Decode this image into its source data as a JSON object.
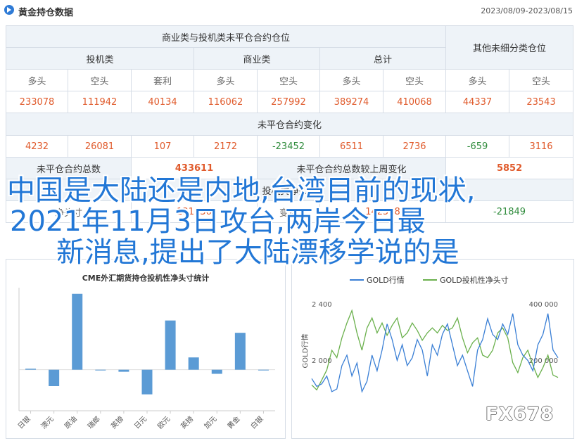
{
  "header": {
    "title": "黄金持仓数据",
    "date_range": "2023/08/09-2023/08/15"
  },
  "table": {
    "section_commercial": "商业类与投机类未平仓合约仓位",
    "section_other": "其他未细分类仓位",
    "groups": [
      "投机类",
      "商业类",
      "总计"
    ],
    "col_labels": [
      "多头",
      "空头",
      "套利",
      "多头",
      "空头",
      "多头",
      "空头",
      "多头",
      "空头"
    ],
    "positions": [
      "233078",
      "111942",
      "40134",
      "116062",
      "257992",
      "389274",
      "410068",
      "44337",
      "23543"
    ],
    "change_title": "未平仓合约变化",
    "changes": [
      "4232",
      "26081",
      "107",
      "2172",
      "-23452",
      "6511",
      "2736",
      "-659",
      "3116"
    ],
    "oi_total_label": "未平仓合约总数",
    "oi_total_value": "433611",
    "oi_change_label": "未平仓合约总数较上周变化",
    "oi_change_value": "5852",
    "row6_title": "投机类净头寸",
    "row7_left": "净头寸",
    "row7_change": "变化",
    "net_value": "121136",
    "net_change": "142508",
    "last_value": "-21849"
  },
  "overlay": {
    "line1": "中国是大陆还是内地,台湾目前的现状,",
    "line2": "2021年11月3日攻台,两岸今日最",
    "line3": "新消息,提出了大陆漂移学说的是"
  },
  "watermark": "FX678",
  "colors": {
    "positive": "#e05a2b",
    "negative": "#2e8b3b",
    "bar": "#5b9bd5",
    "gold_line": "#3a7fd5",
    "net_line": "#6ab04c",
    "overlay_text": "#2277d6"
  },
  "chart_data": [
    {
      "type": "bar",
      "title": "CME外汇期货持仓投机性净头寸统计",
      "categories": [
        "日银",
        "澳元",
        "原油",
        "瑞郎",
        "英镑",
        "日元",
        "欧元",
        "英镑",
        "加元",
        "黄金",
        "白银"
      ],
      "values": [
        0.5,
        -8,
        37,
        0,
        -1,
        -12,
        24,
        6,
        -2,
        18,
        0
      ],
      "ylim": [
        -20,
        40
      ]
    },
    {
      "type": "line",
      "title": "",
      "legend": [
        "GOLD行情",
        "GOLD投机性净头寸"
      ],
      "y_left_label": "GOLD行情",
      "y_left_ticks": [
        "2 400",
        "2 000"
      ],
      "y_right_ticks": [
        "400 000",
        "200 000"
      ],
      "series": [
        {
          "name": "GOLD行情",
          "axis": "left",
          "values": [
            1935,
            1920,
            1925,
            1940,
            1910,
            1915,
            1960,
            1980,
            1940,
            1965,
            1910,
            1930,
            1980,
            1950,
            1990,
            2040,
            2010,
            1970,
            2000,
            1960,
            1975,
            2010,
            1990,
            1940,
            2000,
            1980,
            2020,
            2040,
            2000,
            1960,
            1980,
            1950,
            1920,
            1990,
            2010,
            2050,
            2020,
            2010,
            2040,
            2020,
            2060,
            2000,
            1980,
            1970,
            1950,
            2000,
            2020,
            2060,
            1990,
            1975
          ]
        },
        {
          "name": "GOLD投机性净头寸",
          "axis": "right",
          "values": [
            195000,
            185000,
            205000,
            225000,
            265000,
            250000,
            290000,
            320000,
            345000,
            300000,
            265000,
            310000,
            330000,
            300000,
            320000,
            295000,
            315000,
            330000,
            290000,
            300000,
            320000,
            305000,
            285000,
            300000,
            310000,
            300000,
            315000,
            305000,
            310000,
            330000,
            290000,
            260000,
            280000,
            290000,
            255000,
            250000,
            265000,
            300000,
            310000,
            290000,
            240000,
            220000,
            250000,
            265000,
            235000,
            210000,
            230000,
            255000,
            215000,
            210000
          ]
        }
      ]
    }
  ]
}
